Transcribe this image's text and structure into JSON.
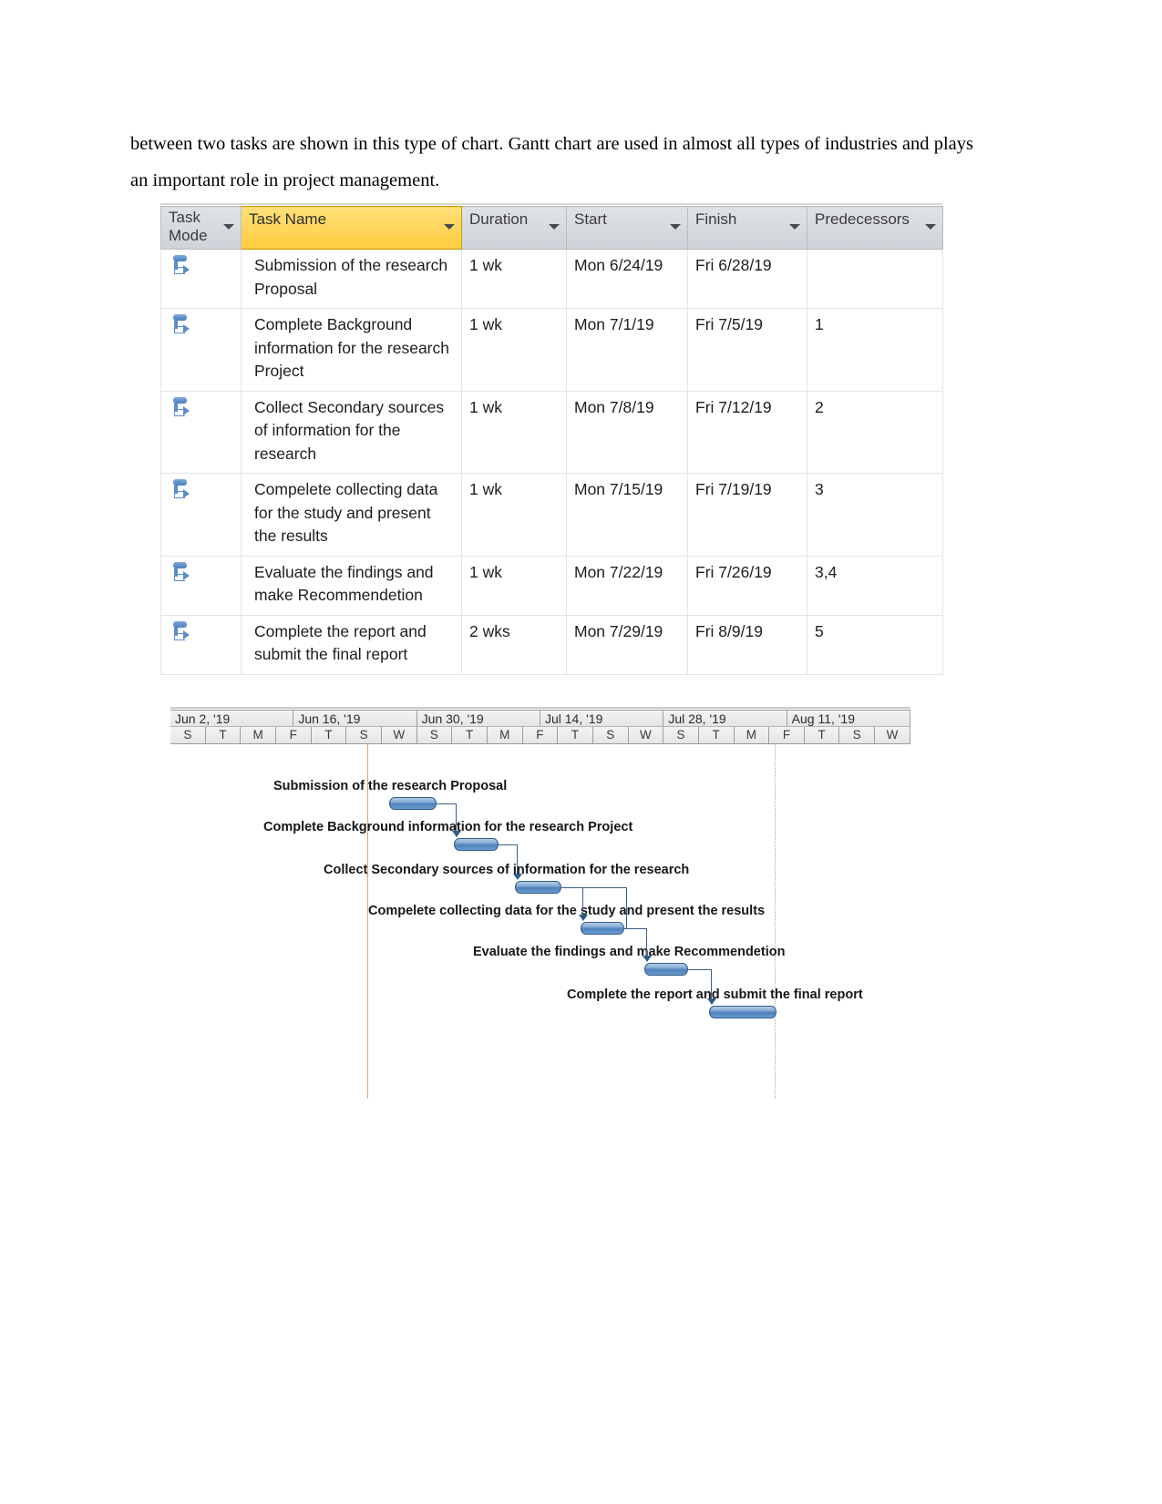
{
  "paragraph": {
    "text": "between two tasks are shown in this type of chart. Gantt chart are used in almost all types of industries and plays an important role in project management."
  },
  "project_table": {
    "columns": [
      {
        "label": "Task Mode",
        "selected": false
      },
      {
        "label": "Task Name",
        "selected": true
      },
      {
        "label": "Duration",
        "selected": false
      },
      {
        "label": "Start",
        "selected": false
      },
      {
        "label": "Finish",
        "selected": false
      },
      {
        "label": "Predecessors",
        "selected": false
      }
    ],
    "rows": [
      {
        "mode": "auto-schedule-icon",
        "name": "Submission of the research Proposal",
        "duration": "1 wk",
        "start": "Mon 6/24/19",
        "finish": "Fri 6/28/19",
        "predecessors": ""
      },
      {
        "mode": "auto-schedule-icon",
        "name": "Complete Background information for the research Project",
        "duration": "1 wk",
        "start": "Mon 7/1/19",
        "finish": "Fri 7/5/19",
        "predecessors": "1"
      },
      {
        "mode": "auto-schedule-icon",
        "name": "Collect Secondary sources of information for the research",
        "duration": "1 wk",
        "start": "Mon 7/8/19",
        "finish": "Fri 7/12/19",
        "predecessors": "2"
      },
      {
        "mode": "auto-schedule-icon",
        "name": "Compelete collecting data for the study and present the results",
        "duration": "1 wk",
        "start": "Mon 7/15/19",
        "finish": "Fri 7/19/19",
        "predecessors": "3"
      },
      {
        "mode": "auto-schedule-icon",
        "name": "Evaluate the findings and make Recommendetion",
        "duration": "1 wk",
        "start": "Mon 7/22/19",
        "finish": "Fri 7/26/19",
        "predecessors": "3,4"
      },
      {
        "mode": "auto-schedule-icon",
        "name": "Complete the report and submit the final report",
        "duration": "2 wks",
        "start": "Mon 7/29/19",
        "finish": "Fri 8/9/19",
        "predecessors": "5"
      }
    ]
  },
  "chart_data": {
    "type": "bar",
    "title": "",
    "orientation": "horizontal",
    "subtype": "gantt",
    "xlabel": "",
    "ylabel": "",
    "grid": false,
    "legend": "none",
    "timeline": {
      "weeks": [
        "Jun 2, '19",
        "Jun 16, '19",
        "Jun 30, '19",
        "Jul 14, '19",
        "Jul 28, '19",
        "Aug 11, '19"
      ],
      "days": [
        "S",
        "T",
        "M",
        "F",
        "T",
        "S",
        "W",
        "S",
        "T",
        "M",
        "F",
        "T",
        "S",
        "W",
        "S",
        "T",
        "M",
        "F",
        "T",
        "S",
        "W"
      ],
      "axis_start": "Jun 2, '19",
      "axis_end": "Aug 17, '19"
    },
    "categories": [
      "Submission of the research Proposal",
      "Complete Background information for the research Project",
      "Collect Secondary sources of information for the research",
      "Compelete collecting data for the study and present the results",
      "Evaluate the findings and make Recommendetion",
      "Complete the report and submit the final report"
    ],
    "tasks": [
      {
        "name": "Submission of the research Proposal",
        "start": "Mon 6/24/19",
        "finish": "Fri 6/28/19",
        "duration_days": 5,
        "duration_label": "1 wk",
        "predecessors": []
      },
      {
        "name": "Complete Background information for the research Project",
        "start": "Mon 7/1/19",
        "finish": "Fri 7/5/19",
        "duration_days": 5,
        "duration_label": "1 wk",
        "predecessors": [
          1
        ]
      },
      {
        "name": "Collect Secondary sources of information for the research",
        "start": "Mon 7/8/19",
        "finish": "Fri 7/12/19",
        "duration_days": 5,
        "duration_label": "1 wk",
        "predecessors": [
          2
        ]
      },
      {
        "name": "Compelete collecting data for the study and present the results",
        "start": "Mon 7/15/19",
        "finish": "Fri 7/19/19",
        "duration_days": 5,
        "duration_label": "1 wk",
        "predecessors": [
          3
        ]
      },
      {
        "name": "Evaluate the findings and make Recommendetion",
        "start": "Mon 7/22/19",
        "finish": "Fri 7/26/19",
        "duration_days": 5,
        "duration_label": "1 wk",
        "predecessors": [
          3,
          4
        ]
      },
      {
        "name": "Complete the report and submit the final report",
        "start": "Mon 7/29/19",
        "finish": "Fri 8/9/19",
        "duration_days": 10,
        "duration_label": "2 wks",
        "predecessors": [
          5
        ]
      }
    ],
    "colors": {
      "bar_fill": "#5d8fc4",
      "bar_border": "#2e5b8c",
      "link_line": "#3a5f85",
      "today_line": "#e2a07a",
      "header_bg": "#eceded",
      "selected_column": "#ffd451"
    }
  }
}
